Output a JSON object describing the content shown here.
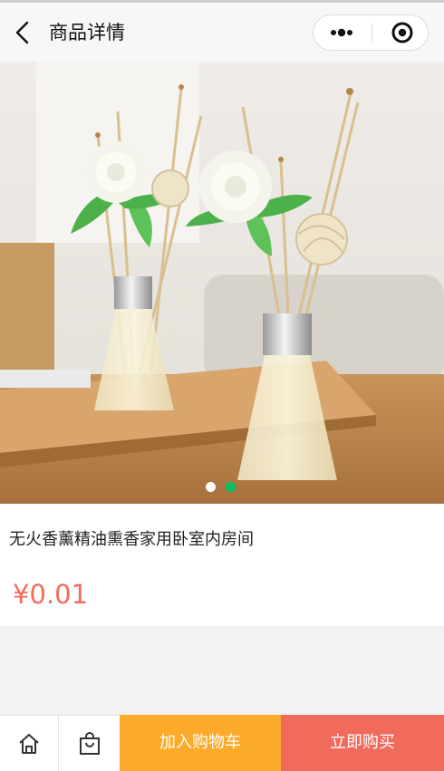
{
  "navbar": {
    "title": "商品详情",
    "back_icon": "chevron-left-icon",
    "more_icon": "more-dots-icon",
    "close_icon": "target-circle-icon"
  },
  "banner": {
    "image_subject": "reed diffuser bottles with white flowers",
    "total_slides": 2,
    "active_slide": 2,
    "dot_colors": {
      "inactive": "#ffffff",
      "active": "#07c160"
    }
  },
  "product": {
    "name": "无火香薰精油熏香家用卧室内房间",
    "price": "¥0.01",
    "price_color": "#f26b5b"
  },
  "bottom_bar": {
    "home_icon": "home-icon",
    "bag_icon": "shopping-bag-icon",
    "add_to_cart": "加入购物车",
    "buy_now": "立即购买",
    "add_to_cart_color": "#fcaa2a",
    "buy_now_color": "#f16b5d"
  }
}
